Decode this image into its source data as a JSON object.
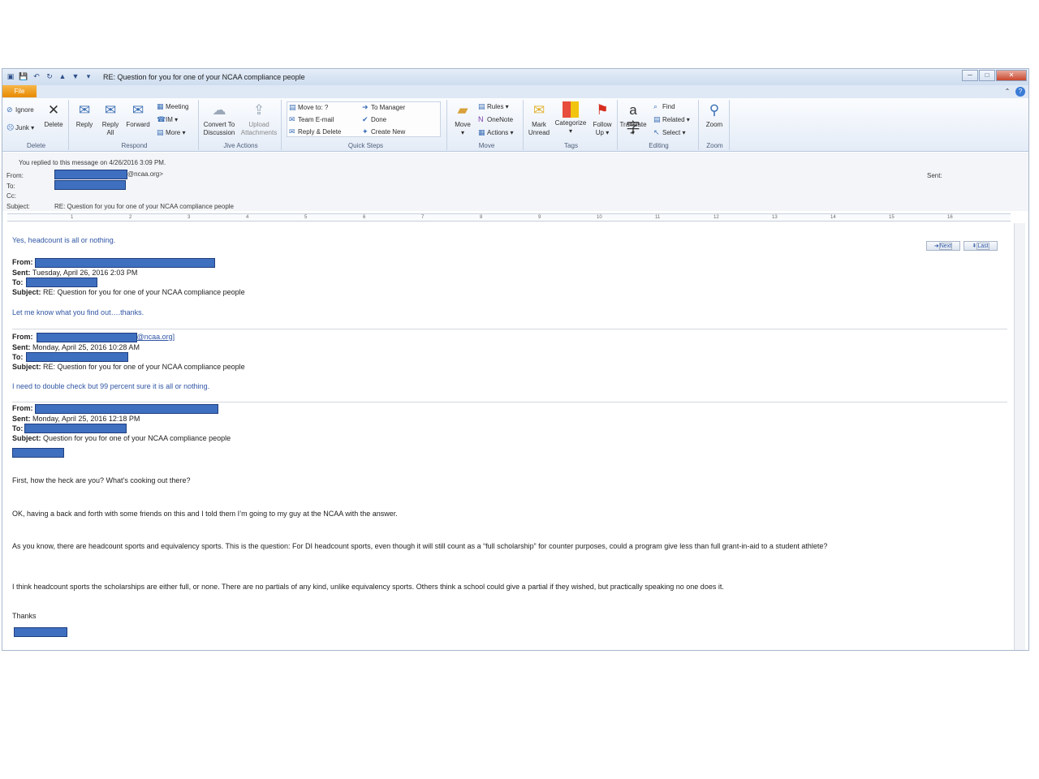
{
  "titlebar": {
    "title": "RE: Question for you for one of your NCAA compliance people"
  },
  "tabs": {
    "file": "File"
  },
  "ribbon": {
    "delete_group": {
      "label": "Delete",
      "ignore": "Ignore",
      "junk": "Junk",
      "delete": "Delete"
    },
    "respond_group": {
      "label": "Respond",
      "reply": "Reply",
      "reply_all_line1": "Reply",
      "reply_all_line2": "All",
      "forward": "Forward",
      "meeting": "Meeting",
      "im": "IM",
      "more": "More"
    },
    "jive_group": {
      "label": "Jive Actions",
      "convert_line1": "Convert To",
      "convert_line2": "Discussion",
      "upload_line1": "Upload",
      "upload_line2": "Attachments"
    },
    "quicksteps_group": {
      "label": "Quick Steps",
      "move_to": "Move to: ?",
      "team_email": "Team E-mail",
      "reply_delete": "Reply & Delete",
      "to_manager": "To Manager",
      "done": "Done",
      "create_new": "Create New"
    },
    "move_group": {
      "label": "Move",
      "move": "Move",
      "rules": "Rules",
      "onenote": "OneNote",
      "actions": "Actions"
    },
    "tags_group": {
      "label": "Tags",
      "mark_line1": "Mark",
      "mark_line2": "Unread",
      "categorize": "Categorize",
      "follow_line1": "Follow",
      "follow_line2": "Up"
    },
    "editing_group": {
      "label": "Editing",
      "translate": "Translate",
      "find": "Find",
      "related": "Related",
      "select": "Select"
    },
    "zoom_group": {
      "label": "Zoom",
      "zoom": "Zoom"
    }
  },
  "header": {
    "replied_info": "You replied to this message on 4/26/2016 3:09 PM.",
    "from_label": "From:",
    "from_suffix": "@ncaa.org>",
    "to_label": "To:",
    "cc_label": "Cc:",
    "subject_label": "Subject:",
    "subject": "RE: Question for you for one of your NCAA compliance people",
    "sent_label": "Sent:"
  },
  "ruler": {
    "ticks": [
      "1",
      "2",
      "3",
      "4",
      "5",
      "6",
      "7",
      "8",
      "9",
      "10",
      "11",
      "12",
      "13",
      "14",
      "15",
      "16"
    ]
  },
  "nav": {
    "next": "Next",
    "last": "Last"
  },
  "body": {
    "reply1": "Yes, headcount is all or nothing.",
    "msg1": {
      "from_label": "From:",
      "sent_label": "Sent:",
      "sent": "Tuesday, April 26, 2016 2:03 PM",
      "to_label": "To:",
      "subject_label": "Subject:",
      "subject": "RE: Question for you for one of your NCAA compliance people",
      "text": "Let me know what you find out….thanks."
    },
    "msg2": {
      "from_label": "From:",
      "from_suffix": "@ncaa.org]",
      "sent_label": "Sent:",
      "sent": "Monday, April 25, 2016 10:28 AM",
      "to_label": "To:",
      "subject_label": "Subject:",
      "subject": "RE: Question for you for one of your NCAA compliance people",
      "text": "I need to double check but 99 percent sure it is all or nothing."
    },
    "msg3": {
      "from_label": "From:",
      "sent_label": "Sent:",
      "sent": "Monday, April 25, 2016 12:18 PM",
      "to_label": "To:",
      "subject_label": "Subject:",
      "subject": "Question for you for one of your NCAA compliance people",
      "para1": "First, how the heck are you?  What’s cooking out there?",
      "para2": "OK, having a back and forth with some friends on this and I told them I’m going to my guy at the NCAA with the answer.",
      "para3": "As you know, there are headcount sports and equivalency sports.  This is the question:  For DI headcount sports, even though it will still count as a “full scholarship” for counter purposes, could a program give less than full grant-in-aid to a student athlete?",
      "para4": "I think headcount sports the scholarships are either full, or none.  There are no partials of any kind, unlike equivalency sports.  Others think a school could give a partial if they wished, but practically speaking no one does it.",
      "thanks": "Thanks"
    }
  }
}
